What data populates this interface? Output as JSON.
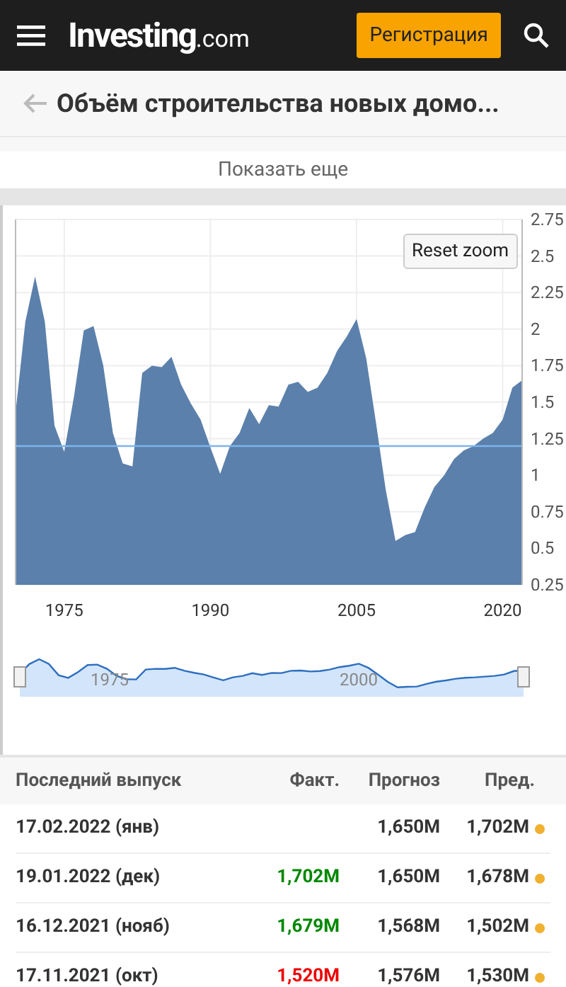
{
  "header": {
    "logo": "Investing",
    "logo_suffix": ".com",
    "register_button": "Регистрация"
  },
  "title_bar": {
    "title": "Объём строительства новых домо..."
  },
  "show_more": "Показать еще",
  "chart": {
    "reset_button": "Reset zoom",
    "chart_data": {
      "type": "area",
      "x": [
        1970,
        1971,
        1972,
        1973,
        1974,
        1975,
        1976,
        1977,
        1978,
        1979,
        1980,
        1981,
        1982,
        1983,
        1984,
        1985,
        1986,
        1987,
        1988,
        1989,
        1990,
        1991,
        1992,
        1993,
        1994,
        1995,
        1996,
        1997,
        1998,
        1999,
        2000,
        2001,
        2002,
        2003,
        2004,
        2005,
        2006,
        2007,
        2008,
        2009,
        2010,
        2011,
        2012,
        2013,
        2014,
        2015,
        2016,
        2017,
        2018,
        2019,
        2020,
        2021,
        2022
      ],
      "series": [
        {
          "color": "#5b80ab",
          "values": [
            1.43,
            2.05,
            2.36,
            2.05,
            1.34,
            1.16,
            1.54,
            1.99,
            2.02,
            1.75,
            1.29,
            1.08,
            1.06,
            1.7,
            1.75,
            1.74,
            1.81,
            1.62,
            1.49,
            1.38,
            1.19,
            1.01,
            1.2,
            1.29,
            1.46,
            1.35,
            1.48,
            1.47,
            1.62,
            1.64,
            1.57,
            1.6,
            1.7,
            1.85,
            1.95,
            2.07,
            1.8,
            1.36,
            0.9,
            0.55,
            0.59,
            0.61,
            0.78,
            0.92,
            1.0,
            1.11,
            1.17,
            1.2,
            1.25,
            1.29,
            1.38,
            1.6,
            1.65
          ]
        },
        {
          "type": "line",
          "color": "#7cb5ec",
          "values": [
            1.2,
            1.2,
            1.2,
            1.2,
            1.2,
            1.2,
            1.2,
            1.2,
            1.2,
            1.2,
            1.2,
            1.2,
            1.2,
            1.2,
            1.2,
            1.2,
            1.2,
            1.2,
            1.2,
            1.2,
            1.2,
            1.2,
            1.2,
            1.2,
            1.2,
            1.2,
            1.2,
            1.2,
            1.2,
            1.2,
            1.2,
            1.2,
            1.2,
            1.2,
            1.2,
            1.2,
            1.2,
            1.2,
            1.2,
            1.2,
            1.2,
            1.2,
            1.2,
            1.2,
            1.2,
            1.2,
            1.2,
            1.2,
            1.2,
            1.2,
            1.2,
            1.2,
            1.2
          ]
        }
      ],
      "xlim": [
        1970,
        2022
      ],
      "ylim": [
        0.25,
        2.75
      ],
      "xticks": [
        1975,
        1990,
        2005,
        2020
      ],
      "yticks": [
        0.25,
        0.5,
        0.75,
        1,
        1.25,
        1.5,
        1.75,
        2,
        2.25,
        2.5,
        2.75
      ],
      "grid": true
    },
    "navigator": {
      "labels": [
        "1975",
        "2000"
      ]
    }
  },
  "table": {
    "columns": [
      "Последний выпуск",
      "Факт.",
      "Прогноз",
      "Пред."
    ],
    "rows": [
      {
        "date": "17.02.2022 (янв)",
        "forecast": "1,650M",
        "previous": {
          "text": "1,702M",
          "color": "#f0b030"
        }
      },
      {
        "date": "19.01.2022 (дек)",
        "actual": {
          "text": "1,702M",
          "color": "#008800"
        },
        "forecast": "1,650M",
        "previous": {
          "text": "1,678M",
          "color": "#f0b030"
        }
      },
      {
        "date": "16.12.2021 (нояб)",
        "actual": {
          "text": "1,679M",
          "color": "#008800"
        },
        "forecast": "1,568M",
        "previous": {
          "text": "1,502M",
          "color": "#f0b030"
        }
      },
      {
        "date": "17.11.2021 (окт)",
        "actual": {
          "text": "1,520M",
          "color": "#ee0000"
        },
        "forecast": "1,576M",
        "previous": {
          "text": "1,530M",
          "color": "#f0b030"
        }
      }
    ]
  }
}
